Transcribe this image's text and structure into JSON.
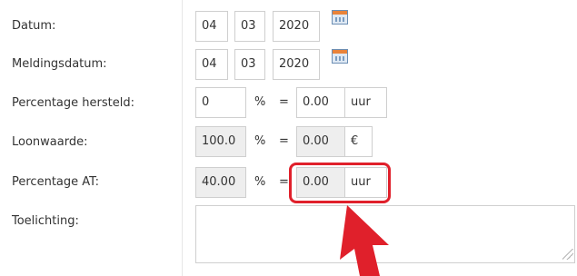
{
  "form": {
    "datum": {
      "label": "Datum:",
      "day": "04",
      "month": "03",
      "year": "2020",
      "icon": "calendar-icon"
    },
    "meldingsdatum": {
      "label": "Meldingsdatum:",
      "day": "04",
      "month": "03",
      "year": "2020",
      "icon": "calendar-icon"
    },
    "percentage_hersteld": {
      "label": "Percentage hersteld:",
      "value": "0",
      "unit": "%",
      "equals": "=",
      "result": "0.00",
      "result_unit": "uur"
    },
    "loonwaarde": {
      "label": "Loonwaarde:",
      "value": "100.0",
      "unit": "%",
      "equals": "=",
      "result": "0.00",
      "result_unit": "€"
    },
    "percentage_at": {
      "label": "Percentage AT:",
      "value": "40.00",
      "unit": "%",
      "equals": "=",
      "result": "0.00",
      "result_unit": "uur"
    },
    "toelichting": {
      "label": "Toelichting:",
      "value": ""
    }
  },
  "annotation": {
    "highlight_color": "#e0202b",
    "arrow_icon": "red-arrow-icon"
  }
}
